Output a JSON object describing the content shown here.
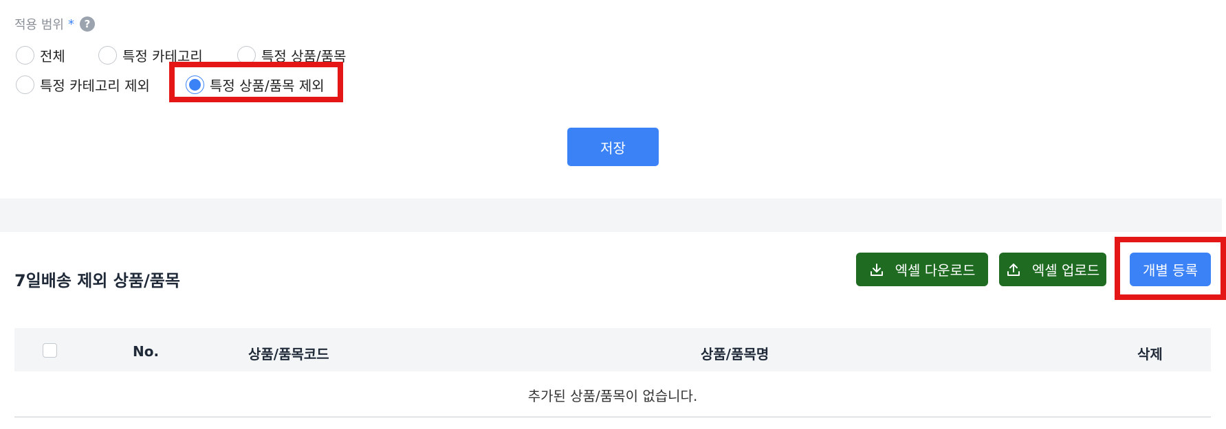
{
  "scope": {
    "label": "적용 범위",
    "required_mark": "*",
    "help_icon": "?",
    "options": [
      {
        "label": "전체",
        "checked": false
      },
      {
        "label": "특정 카테고리",
        "checked": false
      },
      {
        "label": "특정 상품/품목",
        "checked": false
      },
      {
        "label": "특정 카테고리 제외",
        "checked": false
      },
      {
        "label": "특정 상품/품목 제외",
        "checked": true
      }
    ]
  },
  "save_label": "저장",
  "section": {
    "title": "7일배송 제외 상품/품목",
    "excel_download": "엑셀 다운로드",
    "excel_upload": "엑셀 업로드",
    "individual_register": "개별 등록"
  },
  "table": {
    "columns": [
      "No.",
      "상품/품목코드",
      "상품/품목명",
      "삭제"
    ],
    "empty_message": "추가된 상품/품목이 없습니다."
  },
  "colors": {
    "accent": "#3b82f6",
    "excel_green": "#1e6b21",
    "highlight_red": "#e41616"
  }
}
